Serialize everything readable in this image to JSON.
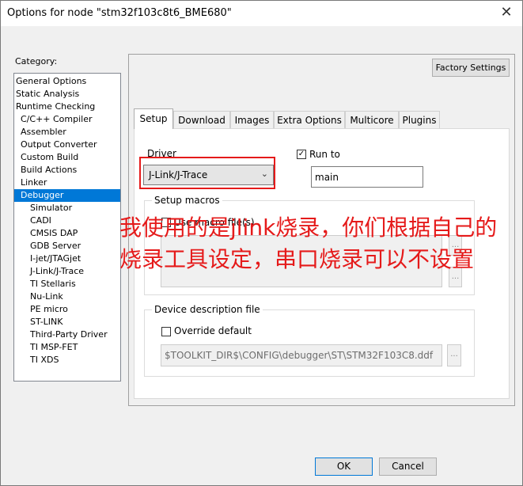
{
  "window": {
    "title": "Options for node \"stm32f103c8t6_BME680\"",
    "close_glyph": "✕"
  },
  "category": {
    "label": "Category:",
    "items": [
      {
        "label": "General Options",
        "indent": 0
      },
      {
        "label": "Static Analysis",
        "indent": 0
      },
      {
        "label": "Runtime Checking",
        "indent": 0
      },
      {
        "label": "C/C++ Compiler",
        "indent": 1
      },
      {
        "label": "Assembler",
        "indent": 1
      },
      {
        "label": "Output Converter",
        "indent": 1
      },
      {
        "label": "Custom Build",
        "indent": 1
      },
      {
        "label": "Build Actions",
        "indent": 1
      },
      {
        "label": "Linker",
        "indent": 1
      },
      {
        "label": "Debugger",
        "indent": 1,
        "selected": true
      },
      {
        "label": "Simulator",
        "indent": 2
      },
      {
        "label": "CADI",
        "indent": 2
      },
      {
        "label": "CMSIS DAP",
        "indent": 2
      },
      {
        "label": "GDB Server",
        "indent": 2
      },
      {
        "label": "I-jet/JTAGjet",
        "indent": 2
      },
      {
        "label": "J-Link/J-Trace",
        "indent": 2
      },
      {
        "label": "TI Stellaris",
        "indent": 2
      },
      {
        "label": "Nu-Link",
        "indent": 2
      },
      {
        "label": "PE micro",
        "indent": 2
      },
      {
        "label": "ST-LINK",
        "indent": 2
      },
      {
        "label": "Third-Party Driver",
        "indent": 2
      },
      {
        "label": "TI MSP-FET",
        "indent": 2
      },
      {
        "label": "TI XDS",
        "indent": 2
      }
    ]
  },
  "factory_settings": "Factory Settings",
  "tabs": [
    "Setup",
    "Download",
    "Images",
    "Extra Options",
    "Multicore",
    "Plugins"
  ],
  "setup": {
    "driver_label": "Driver",
    "driver_value": "J-Link/J-Trace",
    "run_to_label": "Run to",
    "run_to_checked": true,
    "run_to_value": "main",
    "setup_macros_title": "Setup macros",
    "use_macro_label": "Use macro file(s)",
    "device_desc_title": "Device description file",
    "override_label": "Override default",
    "device_desc_path": "$TOOLKIT_DIR$\\CONFIG\\debugger\\ST\\STM32F103C8.ddf",
    "ellipsis": "..."
  },
  "annotation": {
    "line1": "我使用的是jlink烧录，你们根据自己的",
    "line2": "烧录工具设定，串口烧录可以不设置",
    "color": "#e51a1a"
  },
  "buttons": {
    "ok": "OK",
    "cancel": "Cancel"
  }
}
